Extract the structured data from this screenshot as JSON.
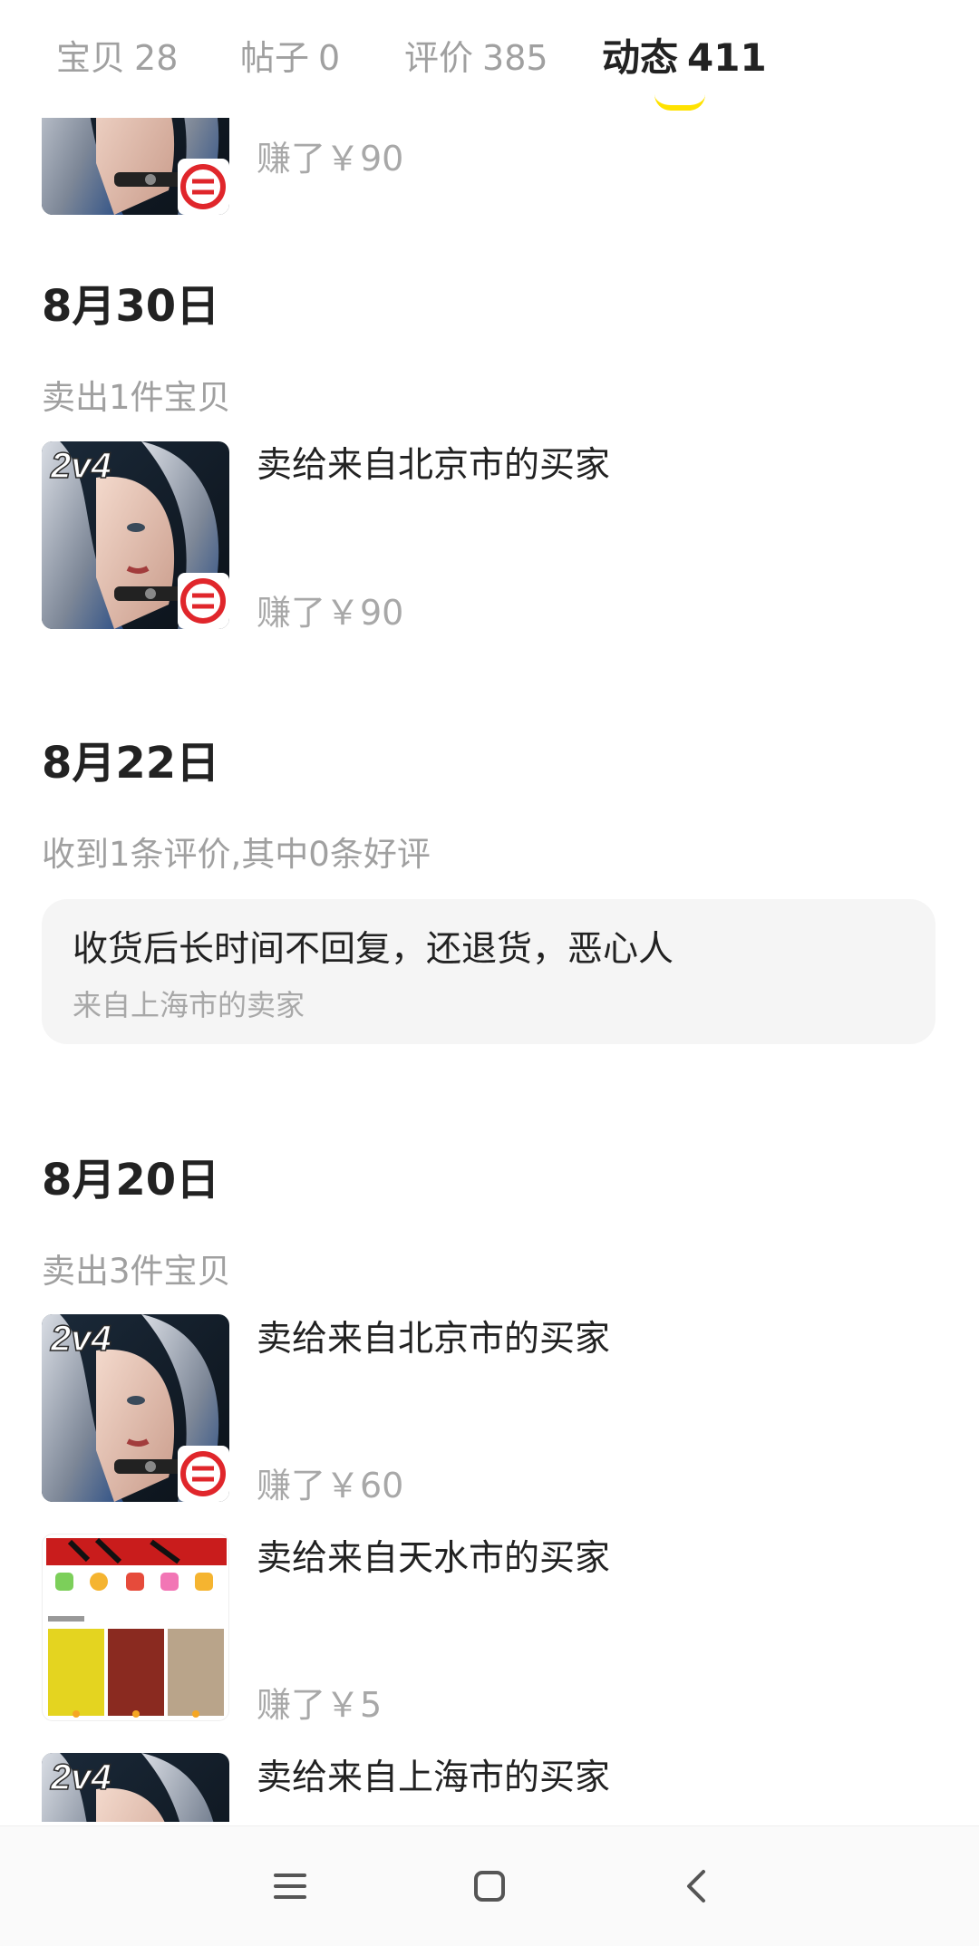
{
  "tabs": [
    {
      "label": "宝贝",
      "count": "28"
    },
    {
      "label": "帖子",
      "count": "0"
    },
    {
      "label": "评价",
      "count": "385"
    },
    {
      "label": "动态",
      "count": "411"
    }
  ],
  "colors": {
    "accent": "#ffe200",
    "muted": "#a0a0a0",
    "text": "#222222",
    "review_bg": "#f5f5f5"
  },
  "feed": {
    "partial_top": {
      "earned": "赚了￥90",
      "thumb_icon": "game-thumbnail-2v4"
    },
    "groups": [
      {
        "date": "8月30日",
        "summary": "卖出1件宝贝",
        "items": [
          {
            "title": "卖给来自北京市的买家",
            "earned": "赚了￥90",
            "thumb_icon": "game-thumbnail-2v4"
          }
        ]
      },
      {
        "date": "8月22日",
        "summary": "收到1条评价,其中0条好评",
        "review": {
          "text": "收货后长时间不回复，还退货，恶心人",
          "from": "来自上海市的卖家"
        }
      },
      {
        "date": "8月20日",
        "summary": "卖出3件宝贝",
        "items": [
          {
            "title": "卖给来自北京市的买家",
            "earned": "赚了￥60",
            "thumb_icon": "game-thumbnail-2v4"
          },
          {
            "title": "卖给来自天水市的买家",
            "earned": "赚了￥5",
            "thumb_icon": "app-screenshot-thumbnail"
          },
          {
            "title": "卖给来自上海市的买家",
            "earned": "",
            "thumb_icon": "game-thumbnail-2v4"
          }
        ]
      }
    ]
  },
  "thumb_text": {
    "logo": "2v4"
  },
  "navbar": {
    "icons": [
      "menu-icon",
      "home-square-icon",
      "back-chevron-icon"
    ]
  }
}
